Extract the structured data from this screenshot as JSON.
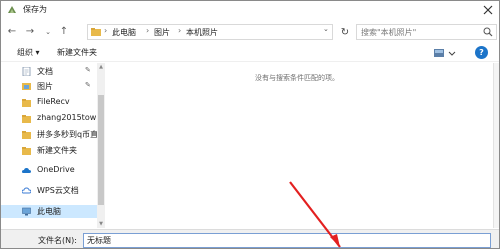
{
  "window": {
    "title": "保存为"
  },
  "address": {
    "crumbs": [
      "此电脑",
      "图片",
      "本机照片"
    ],
    "search_placeholder": "搜索\"本机照片\""
  },
  "toolbar": {
    "organize_label": "组织 ▾",
    "new_folder_label": "新建文件夹",
    "help_label": "?"
  },
  "navigation": {
    "items": [
      {
        "label": "文档",
        "icon": "document-folder-icon",
        "pinned": true
      },
      {
        "label": "图片",
        "icon": "pictures-folder-icon",
        "pinned": true
      },
      {
        "label": "FileRecv",
        "icon": "folder-icon",
        "pinned": false
      },
      {
        "label": "zhang2015towi",
        "icon": "folder-icon",
        "pinned": false
      },
      {
        "label": "拼多多秒到q币直",
        "icon": "folder-icon",
        "pinned": false
      },
      {
        "label": "新建文件夹",
        "icon": "folder-icon",
        "pinned": false
      },
      {
        "label": "OneDrive",
        "icon": "onedrive-cloud-icon",
        "pinned": false
      },
      {
        "label": "WPS云文档",
        "icon": "wps-cloud-icon",
        "pinned": false
      },
      {
        "label": "此电脑",
        "icon": "this-pc-icon",
        "pinned": false,
        "selected": true
      }
    ]
  },
  "content": {
    "empty_message": "没有与搜索条件匹配的项。"
  },
  "filename": {
    "label": "文件名(N):",
    "value": "无标题"
  },
  "colors": {
    "selected_bg": "#cce8ff",
    "folder": "#e8b94a",
    "accent": "#1c74c9",
    "annotation": "#e32020"
  }
}
